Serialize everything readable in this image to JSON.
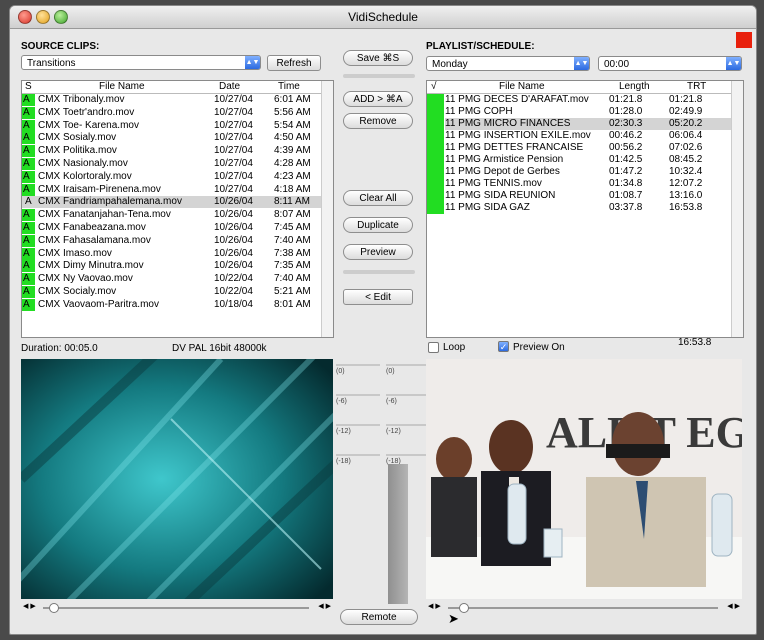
{
  "window": {
    "title": "VidiSchedule"
  },
  "colors": {
    "status_green": "#22dd22",
    "record_red": "#e8200c"
  },
  "source": {
    "title": "SOURCE CLIPS:",
    "category": "Transitions",
    "refresh_label": "Refresh",
    "columns": [
      "S",
      "File Name",
      "Date",
      "Time"
    ],
    "rows": [
      {
        "s": "A",
        "name": "CMX Tribonaly.mov",
        "date": "10/27/04",
        "time": "6:01 AM",
        "green": true
      },
      {
        "s": "A",
        "name": "CMX Toetr'andro.mov",
        "date": "10/27/04",
        "time": "5:56 AM",
        "green": true
      },
      {
        "s": "A",
        "name": "CMX Toe- Karena.mov",
        "date": "10/27/04",
        "time": "5:54 AM",
        "green": true
      },
      {
        "s": "A",
        "name": "CMX Sosialy.mov",
        "date": "10/27/04",
        "time": "4:50 AM",
        "green": true
      },
      {
        "s": "A",
        "name": "CMX Politika.mov",
        "date": "10/27/04",
        "time": "4:39 AM",
        "green": true
      },
      {
        "s": "A",
        "name": "CMX Nasionaly.mov",
        "date": "10/27/04",
        "time": "4:28 AM",
        "green": true
      },
      {
        "s": "A",
        "name": "CMX Kolortoraly.mov",
        "date": "10/27/04",
        "time": "4:23 AM",
        "green": true
      },
      {
        "s": "A",
        "name": "CMX Iraisam-Pirenena.mov",
        "date": "10/27/04",
        "time": "4:18 AM",
        "green": true
      },
      {
        "s": "A",
        "name": "CMX Fandriampahalemana.mov",
        "date": "10/26/04",
        "time": "8:11 AM",
        "green": false
      },
      {
        "s": "A",
        "name": "CMX Fanatanjahan-Tena.mov",
        "date": "10/26/04",
        "time": "8:07 AM",
        "green": true
      },
      {
        "s": "A",
        "name": "CMX Fanabeazana.mov",
        "date": "10/26/04",
        "time": "7:45 AM",
        "green": true
      },
      {
        "s": "A",
        "name": "CMX Fahasalamana.mov",
        "date": "10/26/04",
        "time": "7:40 AM",
        "green": true
      },
      {
        "s": "A",
        "name": "CMX Imaso.mov",
        "date": "10/26/04",
        "time": "7:38 AM",
        "green": true
      },
      {
        "s": "A",
        "name": "CMX Dimy Minutra.mov",
        "date": "10/26/04",
        "time": "7:35 AM",
        "green": true
      },
      {
        "s": "A",
        "name": "CMX Ny Vaovao.mov",
        "date": "10/22/04",
        "time": "7:40 AM",
        "green": true
      },
      {
        "s": "A",
        "name": "CMX Socialy.mov",
        "date": "10/22/04",
        "time": "5:21 AM",
        "green": true
      },
      {
        "s": "A",
        "name": "CMX Vaovaom-Paritra.mov",
        "date": "10/18/04",
        "time": "8:01 AM",
        "green": true
      }
    ],
    "duration": "Duration: 00:05.0",
    "format": "DV PAL 16bit 48000k"
  },
  "middle": {
    "save": "Save",
    "add": "ADD >",
    "remove": "Remove",
    "clear_all": "Clear All",
    "duplicate": "Duplicate",
    "preview": "Preview",
    "edit": "< Edit",
    "remote": "Remote",
    "vu_labels": [
      "(0)",
      "(-6)",
      "(-12)",
      "(-18)"
    ]
  },
  "playlist": {
    "title": "PLAYLIST/SCHEDULE:",
    "day": "Monday",
    "time": "00:00",
    "columns": [
      "√",
      "File Name",
      "Length",
      "TRT"
    ],
    "rows": [
      {
        "name": "11 PMG DECES D'ARAFAT.mov",
        "length": "01:21.8",
        "trt": "01:21.8"
      },
      {
        "name": "11 PMG COPH",
        "length": "01:28.0",
        "trt": "02:49.9"
      },
      {
        "name": "11 PMG MICRO FINANCES",
        "length": "02:30.3",
        "trt": "05:20.2"
      },
      {
        "name": "11 PMG INSERTION EXILE.mov",
        "length": "00:46.2",
        "trt": "06:06.4"
      },
      {
        "name": "11 PMG DETTES FRANCAISE",
        "length": "00:56.2",
        "trt": "07:02.6"
      },
      {
        "name": "11 PMG Armistice Pension",
        "length": "01:42.5",
        "trt": "08:45.2"
      },
      {
        "name": "11 PMG Depot de Gerbes",
        "length": "01:47.2",
        "trt": "10:32.4"
      },
      {
        "name": "11 PMG TENNIS.mov",
        "length": "01:34.8",
        "trt": "12:07.2"
      },
      {
        "name": "11 PMG SIDA REUNION",
        "length": "01:08.7",
        "trt": "13:16.0"
      },
      {
        "name": "11 PMG SIDA GAZ",
        "length": "03:37.8",
        "trt": "16:53.8"
      }
    ],
    "loop": "Loop",
    "preview_on": "Preview On",
    "total": "16:53.8",
    "banner_text": "ALE T  EGLI"
  }
}
